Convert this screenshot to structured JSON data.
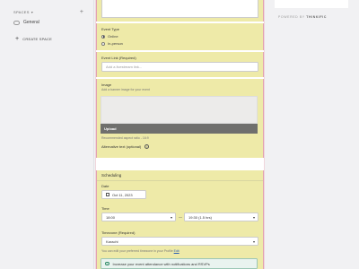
{
  "sidebar": {
    "spaces_label": "SPACES",
    "space_item": "General",
    "create_space": "CREATE SPACE"
  },
  "form": {
    "event_type": {
      "label": "Event Type",
      "options": [
        "Online",
        "In-person"
      ],
      "selected": "Online"
    },
    "event_link": {
      "label": "Event Link (Required)",
      "placeholder": "Add a livestream link..."
    },
    "image": {
      "label": "Image",
      "sub": "Add a banner image for your event",
      "upload_label": "Upload",
      "aspect_note": "Recommended aspect ratio - 16:9",
      "alt_text_label": "Alternative text (optional)"
    },
    "scheduling": {
      "heading": "Scheduling",
      "date_label": "Date",
      "date_value": "Oct 11, 2023",
      "time_label": "Time",
      "start_time": "18:00",
      "end_time": "19:30 (1.5 hrs)",
      "separator": "—",
      "timezone_label": "Timezone (Required)",
      "timezone_value": "Karachi",
      "timezone_note_prefix": "You can edit your preferred timezone in your Profile",
      "timezone_note_link": "Edit"
    },
    "banner": {
      "text": "Increase your event attendance with notifications and RSVPs"
    }
  },
  "right_panel": {
    "powered_prefix": "POWERED BY",
    "powered_brand": "THINKIFIC"
  }
}
